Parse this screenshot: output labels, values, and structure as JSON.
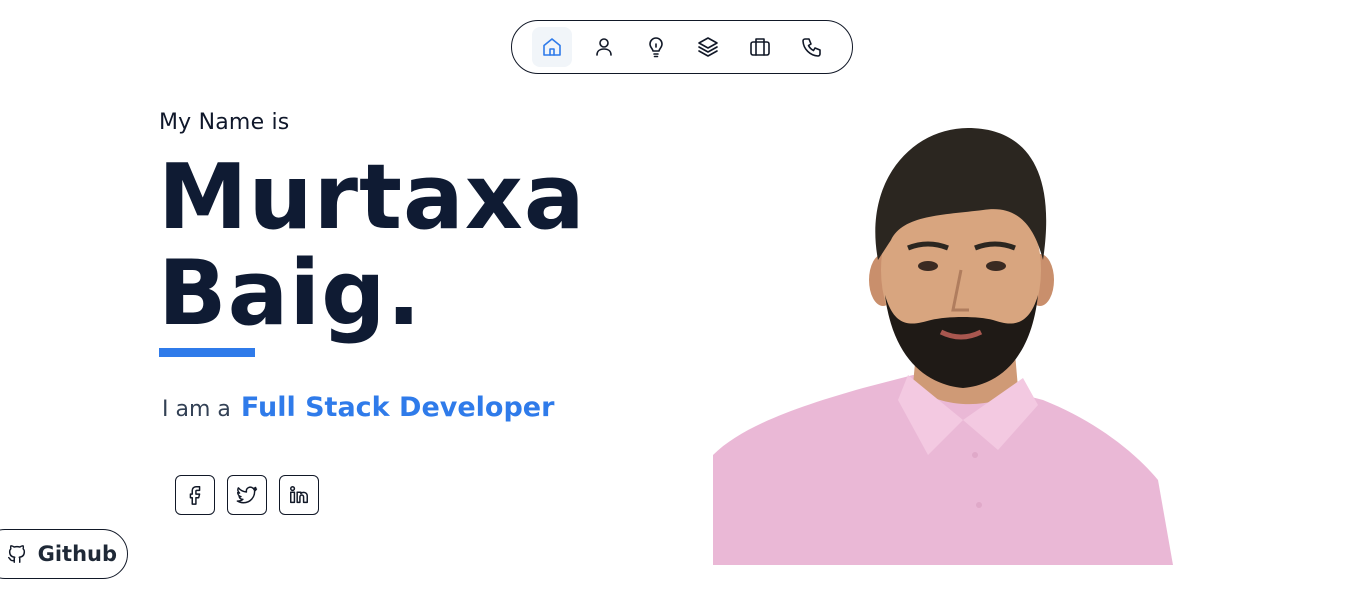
{
  "nav": {
    "items": [
      {
        "icon": "home-icon",
        "active": true
      },
      {
        "icon": "user-icon",
        "active": false
      },
      {
        "icon": "lightbulb-icon",
        "active": false
      },
      {
        "icon": "layers-icon",
        "active": false
      },
      {
        "icon": "briefcase-icon",
        "active": false
      },
      {
        "icon": "phone-icon",
        "active": false
      }
    ]
  },
  "hero": {
    "intro": "My Name is",
    "first_name": "Murtaxa",
    "last_name": "Baig.",
    "role_prefix": "I am a",
    "role_title": "Full Stack Developer"
  },
  "socials": [
    {
      "icon": "facebook-icon"
    },
    {
      "icon": "twitter-icon"
    },
    {
      "icon": "linkedin-icon"
    }
  ],
  "github": {
    "label": "Github",
    "icon": "github-icon"
  },
  "colors": {
    "accent": "#2f7bea",
    "heading": "#0f1b33",
    "border": "#111827",
    "shirt": "#eab8d6",
    "skin": "#d8a57f",
    "hair": "#2b2620"
  }
}
